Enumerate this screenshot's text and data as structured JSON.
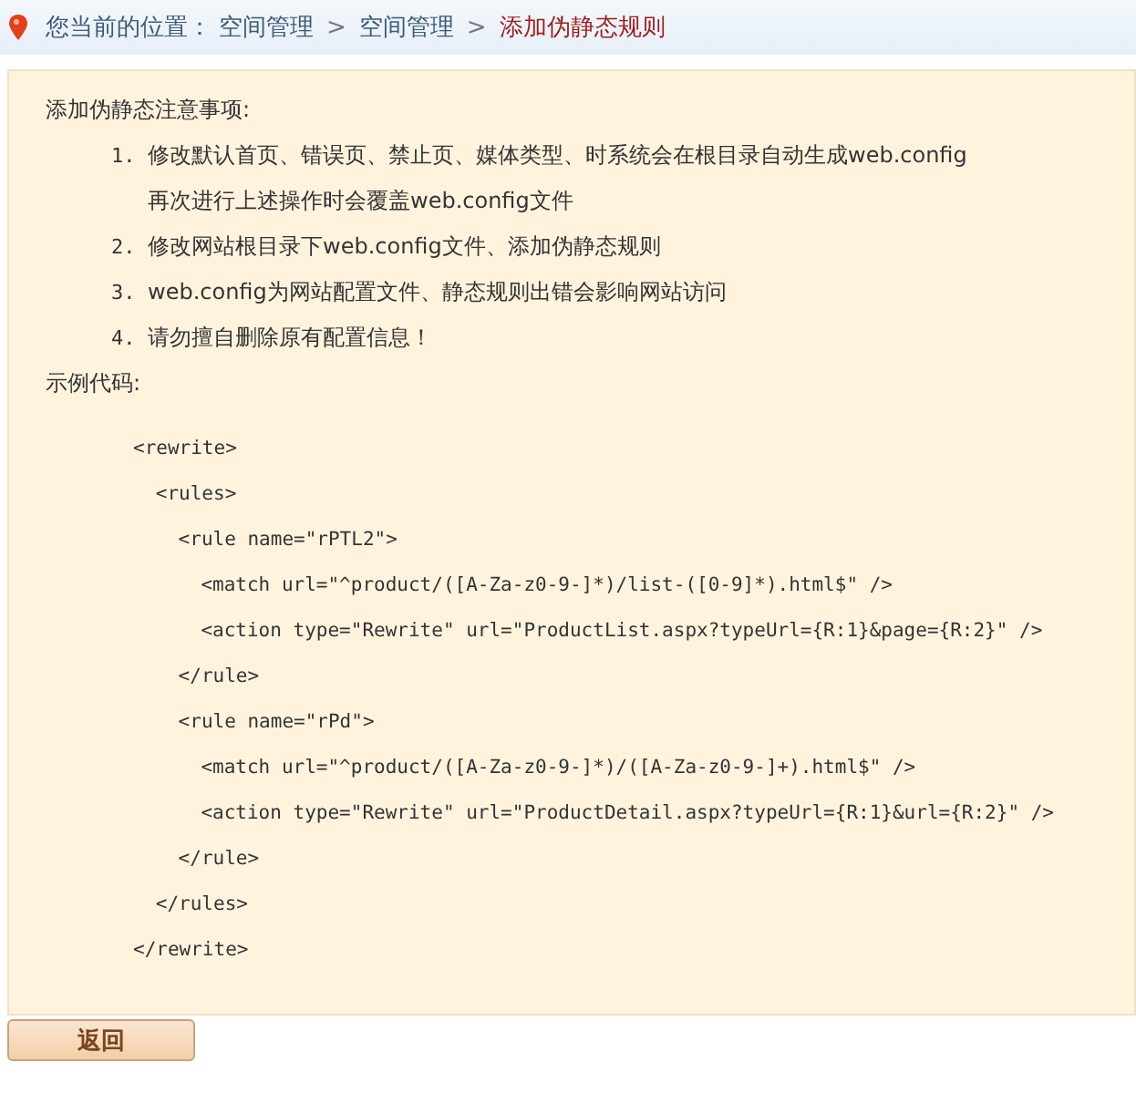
{
  "breadcrumb": {
    "label": "您当前的位置：",
    "separator": ">",
    "items": [
      {
        "text": "空间管理",
        "current": false
      },
      {
        "text": "空间管理",
        "current": false
      },
      {
        "text": "添加伪静态规则",
        "current": true
      }
    ]
  },
  "notes": {
    "title": "添加伪静态注意事项:",
    "items": [
      {
        "number": "1.",
        "lines": [
          "修改默认首页、错误页、禁止页、媒体类型、时系统会在根目录自动生成web.config",
          "再次进行上述操作时会覆盖web.config文件"
        ]
      },
      {
        "number": "2.",
        "lines": [
          "修改网站根目录下web.config文件、添加伪静态规则"
        ]
      },
      {
        "number": "3.",
        "lines": [
          "web.config为网站配置文件、静态规则出错会影响网站访问"
        ]
      },
      {
        "number": "4.",
        "lines": [
          "请勿擅自删除原有配置信息！"
        ]
      }
    ]
  },
  "example": {
    "title": "示例代码:",
    "code": [
      {
        "open": "<rewrite>",
        "close": "</rewrite>",
        "children": [
          {
            "open": "<rules>",
            "close": "</rules>",
            "children": [
              {
                "open": "<rule name=\"rPTL2\">",
                "close": "</rule>",
                "children": [
                  {
                    "open": "<match url=\"^product/([A-Za-z0-9-]*)/list-([0-9]*).html$\" />"
                  },
                  {
                    "open": "<action type=\"Rewrite\" url=\"ProductList.aspx?typeUrl={R:1}&page={R:2}\" />"
                  }
                ]
              },
              {
                "open": "<rule name=\"rPd\">",
                "close": "</rule>",
                "children": [
                  {
                    "open": "<match url=\"^product/([A-Za-z0-9-]*)/([A-Za-z0-9-]+).html$\" />"
                  },
                  {
                    "open": "<action type=\"Rewrite\" url=\"ProductDetail.aspx?typeUrl={R:1}&url={R:2}\" />"
                  }
                ]
              }
            ]
          }
        ]
      }
    ]
  },
  "buttons": [
    "返回"
  ]
}
